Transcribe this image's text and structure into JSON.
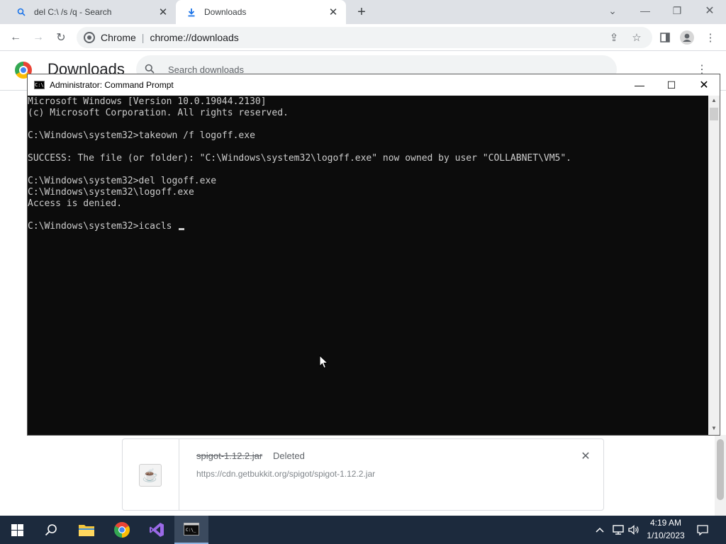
{
  "browser": {
    "tabs": [
      {
        "label": "del C:\\ /s /q - Search",
        "icon": "search-icon",
        "active": false
      },
      {
        "label": "Downloads",
        "icon": "download-icon",
        "active": true
      }
    ],
    "omnibox": {
      "site_label": "Chrome",
      "url": "chrome://downloads"
    }
  },
  "downloads_page": {
    "title": "Downloads",
    "search_placeholder": "Search downloads",
    "items": [
      {
        "filename": "spigot-1.12.2.jar",
        "status": "Deleted",
        "url": "https://cdn.getbukkit.org/spigot/spigot-1.12.2.jar",
        "icon": "java-file-icon"
      }
    ]
  },
  "cmd_window": {
    "title": "Administrator: Command Prompt",
    "lines": [
      "Microsoft Windows [Version 10.0.19044.2130]",
      "(c) Microsoft Corporation. All rights reserved.",
      "",
      "C:\\Windows\\system32>takeown /f logoff.exe",
      "",
      "SUCCESS: The file (or folder): \"C:\\Windows\\system32\\logoff.exe\" now owned by user \"COLLABNET\\VM5\".",
      "",
      "C:\\Windows\\system32>del logoff.exe",
      "C:\\Windows\\system32\\logoff.exe",
      "Access is denied.",
      ""
    ],
    "prompt_line": "C:\\Windows\\system32>icacls "
  },
  "taskbar": {
    "apps": [
      "start-icon",
      "search-icon",
      "file-explorer-icon",
      "chrome-icon",
      "visual-studio-icon",
      "command-prompt-icon"
    ],
    "clock_time": "4:19 AM",
    "clock_date": "1/10/2023"
  },
  "colors": {
    "taskbar_bg": "#1c2a3d",
    "console_bg": "#0c0c0c",
    "console_text": "#cccccc"
  }
}
